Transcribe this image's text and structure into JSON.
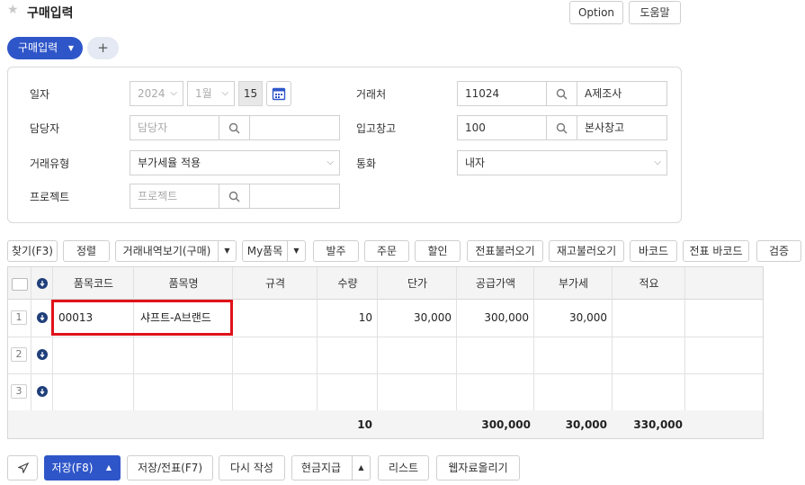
{
  "header": {
    "title": "구매입력",
    "option_label": "Option",
    "help_label": "도움말"
  },
  "tabs": {
    "active_label": "구매입력",
    "add_label": "+"
  },
  "form": {
    "date": {
      "label": "일자",
      "year": "2024",
      "month": "1월",
      "day": "15"
    },
    "vendor": {
      "label": "거래처",
      "code": "11024",
      "name": "A제조사"
    },
    "manager": {
      "label": "담당자",
      "placeholder": "담당자"
    },
    "warehouse": {
      "label": "입고창고",
      "code": "100",
      "name": "본사창고"
    },
    "trade_type": {
      "label": "거래유형",
      "value": "부가세율 적용"
    },
    "currency": {
      "label": "통화",
      "value": "내자"
    },
    "project": {
      "label": "프로젝트",
      "placeholder": "프로젝트"
    }
  },
  "toolbar": {
    "find": "찾기(F3)",
    "sort": "정렬",
    "history": "거래내역보기(구매)",
    "my_items": "My품목",
    "order": "발주",
    "purchase_order": "주문",
    "discount": "할인",
    "load_slip": "전표불러오기",
    "load_stock": "재고불러오기",
    "barcode": "바코드",
    "slip_barcode": "전표 바코드",
    "verify": "검증"
  },
  "grid": {
    "headers": [
      "품목코드",
      "품목명",
      "규격",
      "수량",
      "단가",
      "공급가액",
      "부가세",
      "적요"
    ],
    "rows": [
      {
        "num": "1",
        "code": "00013",
        "name": "샤프트-A브랜드",
        "spec": "",
        "qty": "10",
        "price": "30,000",
        "supply": "300,000",
        "vat": "30,000",
        "memo": ""
      },
      {
        "num": "2",
        "code": "",
        "name": "",
        "spec": "",
        "qty": "",
        "price": "",
        "supply": "",
        "vat": "",
        "memo": ""
      },
      {
        "num": "3",
        "code": "",
        "name": "",
        "spec": "",
        "qty": "",
        "price": "",
        "supply": "",
        "vat": "",
        "memo": ""
      }
    ],
    "totals": {
      "qty": "10",
      "supply": "300,000",
      "vat": "30,000",
      "total": "330,000"
    }
  },
  "bottom": {
    "save": "저장(F8)",
    "save_slip": "저장/전표(F7)",
    "rewrite": "다시 작성",
    "cash_pay": "현금지급",
    "list": "리스트",
    "upload": "웹자료올리기"
  }
}
